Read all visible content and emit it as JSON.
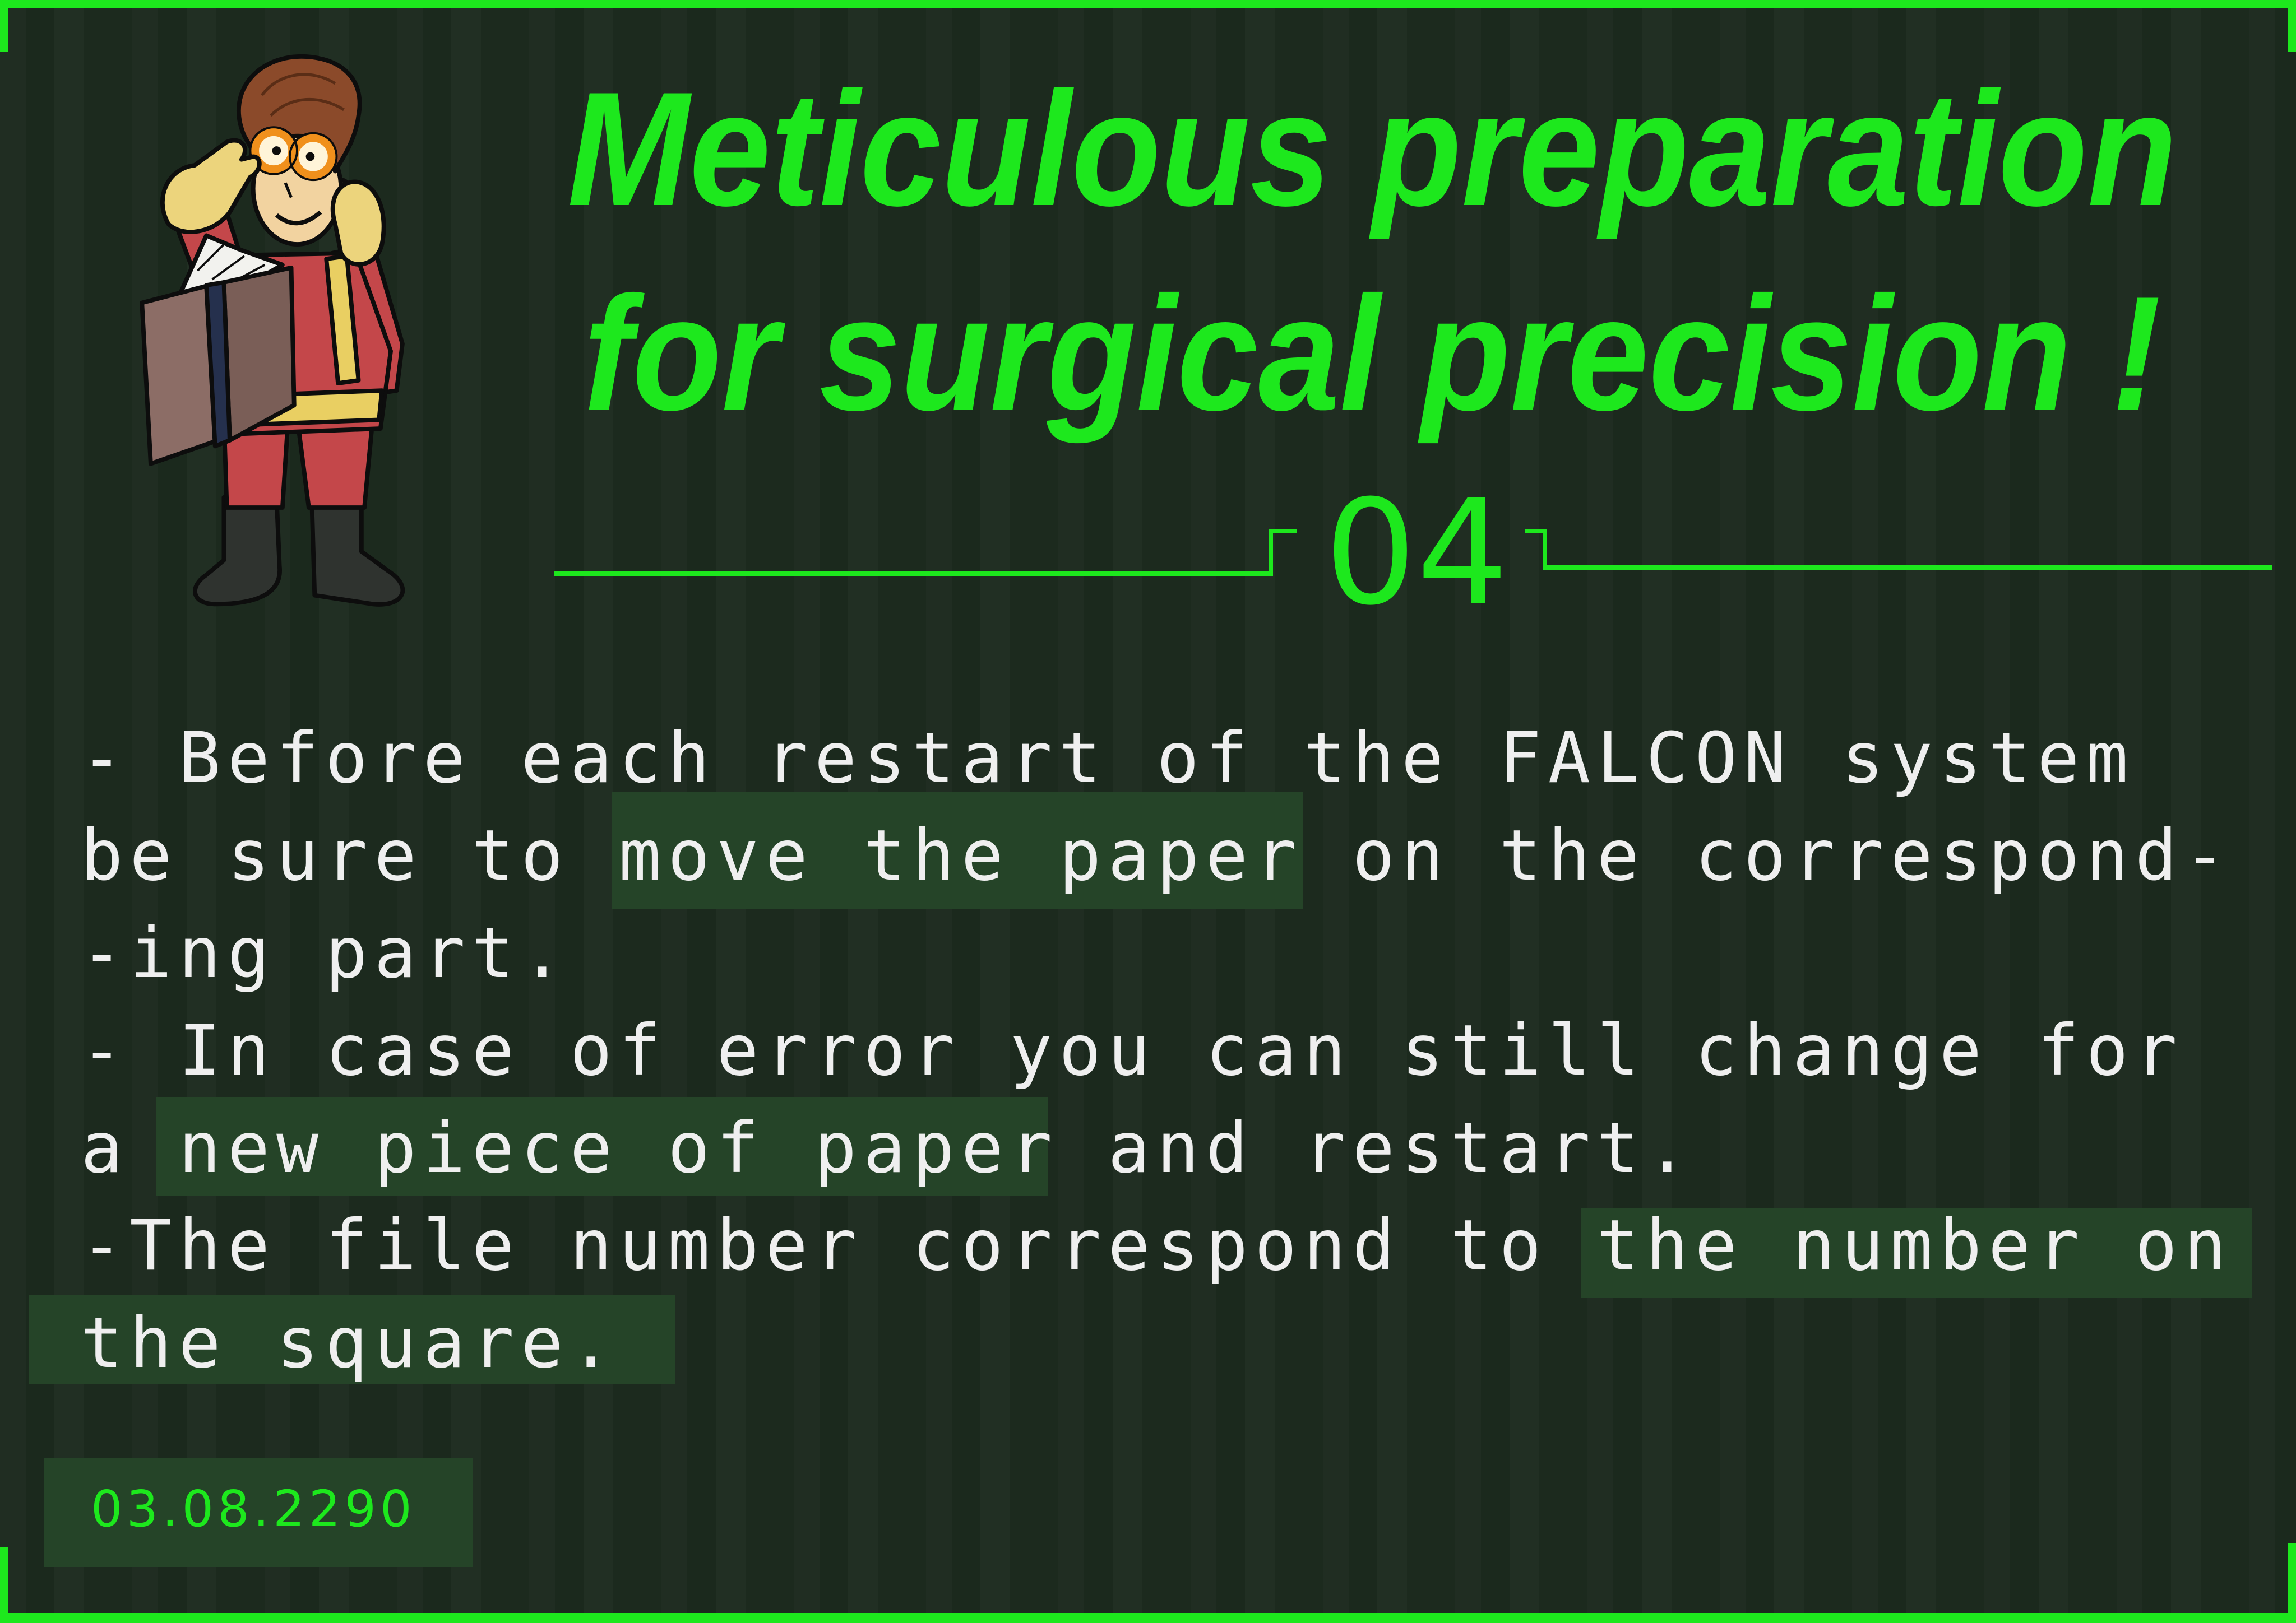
{
  "title": {
    "line1": "Meticulous preparation",
    "line2": "for surgical precision !"
  },
  "section_number": "04",
  "instructions": {
    "lines": [
      {
        "segments": [
          {
            "text": "- Before each restart of the FALCON system",
            "highlight": false
          }
        ]
      },
      {
        "segments": [
          {
            "text": "be sure to ",
            "highlight": false
          },
          {
            "text": "move the paper",
            "highlight": true
          },
          {
            "text": " on the correspond-",
            "highlight": false
          }
        ]
      },
      {
        "segments": [
          {
            "text": "-ing part.",
            "highlight": false
          }
        ]
      },
      {
        "segments": [
          {
            "text": "- In case of error you can still change for",
            "highlight": false
          }
        ]
      },
      {
        "segments": [
          {
            "text": "a ",
            "highlight": false
          },
          {
            "text": "new piece of paper",
            "highlight": true
          },
          {
            "text": " and restart.",
            "highlight": false
          }
        ]
      },
      {
        "segments": [
          {
            "text": "-The file number correspond to ",
            "highlight": false
          },
          {
            "text": "the number on",
            "highlight": true
          }
        ]
      },
      {
        "segments": [
          {
            "text": "the square.",
            "highlight": true
          }
        ]
      }
    ]
  },
  "date": "03.08.2290",
  "illustration": {
    "icon": "vault-boy-reading-book-icon"
  },
  "colors": {
    "accent": "#1de81d",
    "background": "#1c2a1e",
    "highlight": "#254428",
    "text": "#efefef"
  }
}
